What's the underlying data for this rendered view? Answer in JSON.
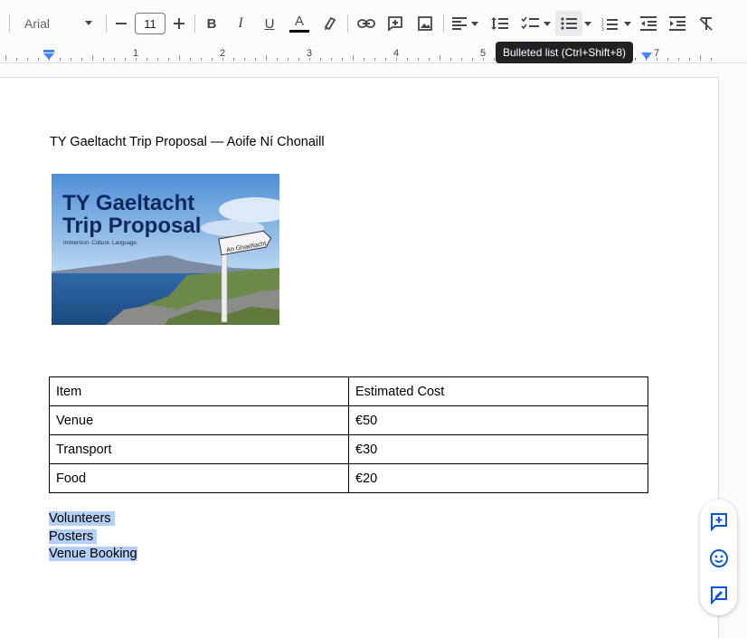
{
  "toolbar": {
    "font_name": "Arial",
    "font_size": "11",
    "text_color": "#000000"
  },
  "ruler": {
    "labels": [
      "1",
      "2",
      "3",
      "4",
      "5",
      "7"
    ]
  },
  "tooltip": {
    "text": "Bulleted list (Ctrl+Shift+8)"
  },
  "document": {
    "title": "TY Gaeltacht Trip Proposal — Aoife Ní Chonaill",
    "hero_image": {
      "title_line1": "TY Gaeltacht",
      "title_line2": "Trip Proposal",
      "subtitle": "Immersion. Culture. Language.",
      "sign_text": "An Ghaeltacht"
    },
    "table": {
      "rows": [
        [
          "Item",
          "Estimated Cost"
        ],
        [
          "Venue",
          "€50"
        ],
        [
          "Transport",
          "€30"
        ],
        [
          "Food",
          "€20"
        ]
      ]
    },
    "selected_lines": [
      "Volunteers",
      "Posters",
      "Venue Booking"
    ]
  },
  "colors": {
    "selection": "#b4cff5",
    "accent": "#0b57d0"
  }
}
